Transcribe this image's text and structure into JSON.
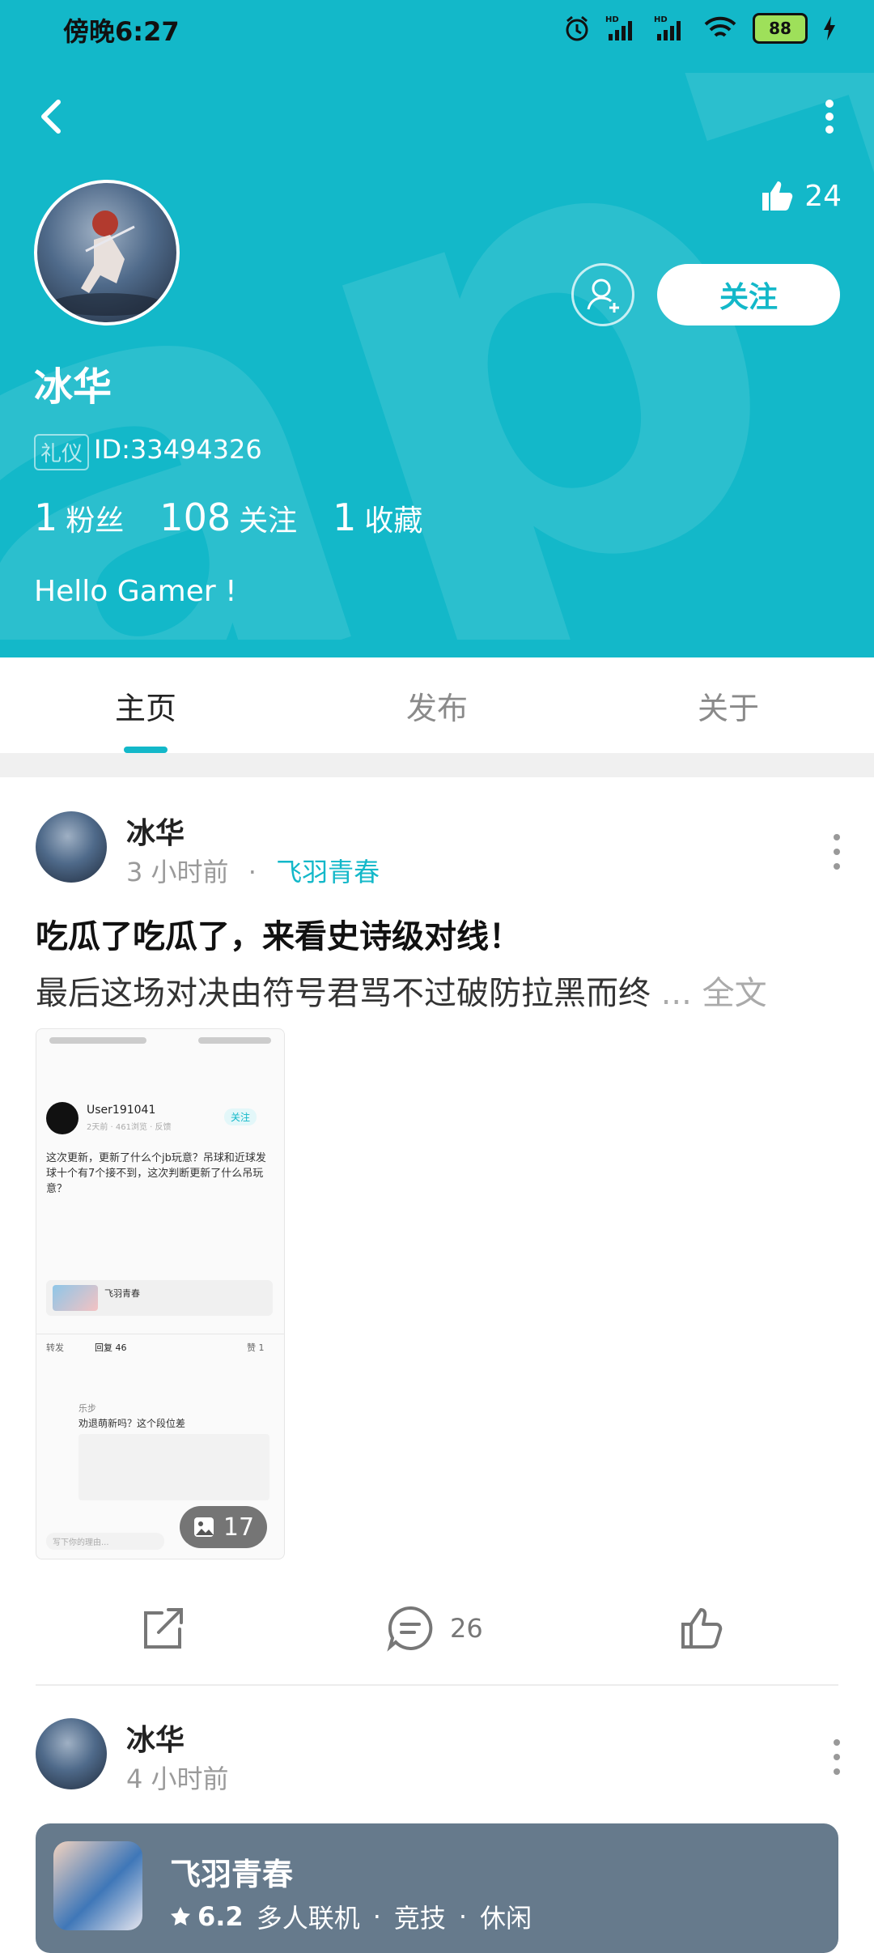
{
  "status_bar": {
    "time": "傍晚6:27",
    "battery": "88",
    "wifi_label": "6",
    "hd1": "HD",
    "hd2": "HD"
  },
  "profile": {
    "likes": "24",
    "name": "冰华",
    "badge": "礼仪",
    "id_text": "ID:33494326",
    "stats": [
      {
        "num": "1",
        "label": "粉丝"
      },
      {
        "num": "108",
        "label": "关注"
      },
      {
        "num": "1",
        "label": "收藏"
      }
    ],
    "bio": "Hello Gamer !",
    "follow_label": "关注"
  },
  "tabs": [
    {
      "label": "主页",
      "active": true
    },
    {
      "label": "发布",
      "active": false
    },
    {
      "label": "关于",
      "active": false
    }
  ],
  "post1": {
    "author": "冰华",
    "time": "3 小时前",
    "separator": "·",
    "game": "飞羽青春",
    "title": "吃瓜了吃瓜了，来看史诗级对线！",
    "excerpt": "最后这场对决由符号君骂不过破防拉黑而终",
    "more": " ... 全文",
    "image_count": "17",
    "comments": "26"
  },
  "screenshot_thumb": {
    "user": "User191041",
    "follow": "关注",
    "meta": "2天前 · 461浏览 · 反馈",
    "body": "这次更新，更新了什么个jb玩意？吊球和近球发球十个有7个接不到，这次判断更新了什么吊玩意？",
    "game": "飞羽青春",
    "tab1": "转发",
    "tab2": "回复 46",
    "tab3": "赞 1",
    "reply_user": "乐步",
    "reply_text": "劝退萌新吗？这个段位差",
    "input": "写下你的理由..."
  },
  "post2": {
    "author": "冰华",
    "time": "4 小时前"
  },
  "game_card": {
    "name": "飞羽青春",
    "rating": "6.2",
    "tags": [
      "多人联机",
      "竞技",
      "休闲"
    ],
    "sep": "·"
  },
  "colors": {
    "accent": "#13b8c9",
    "card": "#667a8c"
  }
}
